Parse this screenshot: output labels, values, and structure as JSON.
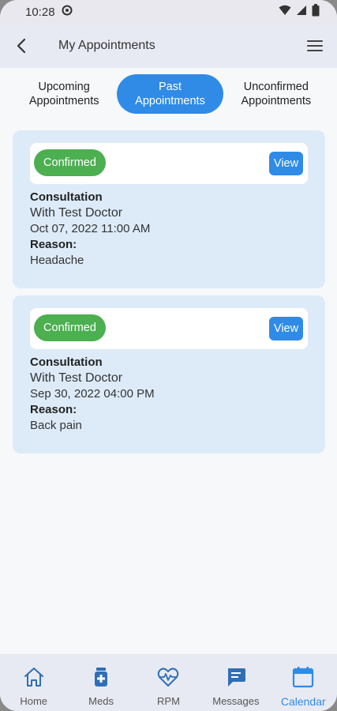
{
  "status_bar": {
    "time": "10:28"
  },
  "header": {
    "title": "My Appointments"
  },
  "tabs": [
    {
      "line1": "Upcoming",
      "line2": "Appointments",
      "active": false
    },
    {
      "line1": "Past",
      "line2": "Appointments",
      "active": true
    },
    {
      "line1": "Unconfirmed",
      "line2": "Appointments",
      "active": false
    }
  ],
  "appointments": [
    {
      "status": "Confirmed",
      "view_label": "View",
      "type": "Consultation",
      "doctor": "With Test Doctor",
      "datetime": "Oct 07, 2022 11:00 AM",
      "reason_label": "Reason:",
      "reason": "Headache"
    },
    {
      "status": "Confirmed",
      "view_label": "View",
      "type": "Consultation",
      "doctor": "With Test Doctor",
      "datetime": "Sep 30, 2022 04:00 PM",
      "reason_label": "Reason:",
      "reason": "Back pain"
    }
  ],
  "bottom_nav": [
    {
      "label": "Home",
      "icon": "home-icon",
      "active": false
    },
    {
      "label": "Meds",
      "icon": "meds-icon",
      "active": false
    },
    {
      "label": "RPM",
      "icon": "heart-pulse-icon",
      "active": false
    },
    {
      "label": "Messages",
      "icon": "message-icon",
      "active": false
    },
    {
      "label": "Calendar",
      "icon": "calendar-icon",
      "active": true
    }
  ],
  "colors": {
    "accent": "#2f8be6",
    "confirmed": "#4caf50",
    "card_bg": "#ddebf9",
    "header_bg": "#e8eaf3"
  }
}
